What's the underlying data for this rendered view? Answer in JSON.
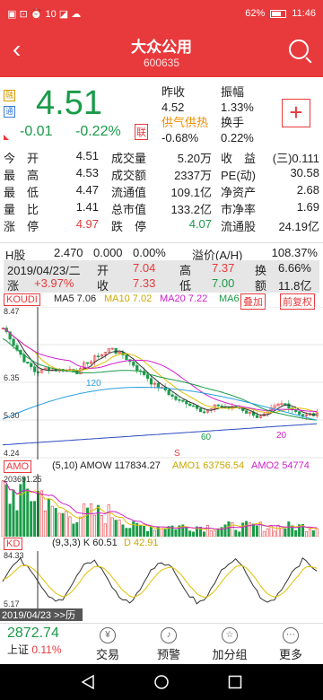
{
  "status": {
    "left_icons": "▣ ⊡ ⏰ 10 ◪ ☁",
    "battery_pct": "62%",
    "time": "11:46"
  },
  "header": {
    "title": "大众公用",
    "code": "600635"
  },
  "quote": {
    "tag1": "融",
    "tag2": "通",
    "price": "4.51",
    "change": "-0.01",
    "change_pct": "-0.22%",
    "lian": "联",
    "zuoshou_label": "昨收",
    "zuoshou": "4.52",
    "zhenfu_label": "振幅",
    "zhenfu": "1.33%",
    "gongqi_label": "供气供热",
    "gongqi": "-0.68%",
    "huanshou_label": "换手",
    "huanshou": "0.22%"
  },
  "stats": [
    [
      {
        "k": "今　开",
        "v": "4.51",
        "c": ""
      },
      {
        "k": "成交量",
        "v": "5.20万",
        "c": ""
      },
      {
        "k": "收　益",
        "v": "(三)0.111",
        "c": ""
      }
    ],
    [
      {
        "k": "最　高",
        "v": "4.53",
        "c": ""
      },
      {
        "k": "成交额",
        "v": "2337万",
        "c": ""
      },
      {
        "k": "PE(动)",
        "v": "30.58",
        "c": ""
      }
    ],
    [
      {
        "k": "最　低",
        "v": "4.47",
        "c": ""
      },
      {
        "k": "流通值",
        "v": "109.1亿",
        "c": ""
      },
      {
        "k": "净资产",
        "v": "2.68",
        "c": ""
      }
    ],
    [
      {
        "k": "量　比",
        "v": "1.41",
        "c": ""
      },
      {
        "k": "总市值",
        "v": "133.2亿",
        "c": ""
      },
      {
        "k": "市净率",
        "v": "1.69",
        "c": ""
      }
    ],
    [
      {
        "k": "涨　停",
        "v": "4.97",
        "c": "red"
      },
      {
        "k": "跌　停",
        "v": "4.07",
        "c": "green"
      },
      {
        "k": "流通股",
        "v": "24.19亿",
        "c": ""
      }
    ]
  ],
  "hshare": {
    "label": "H股",
    "v1": "2.470",
    "v2": "0.000",
    "v3": "0.00%",
    "premium_label": "溢价(A/H)",
    "premium": "108.37%"
  },
  "day": {
    "date": "2019/04/23/二",
    "open_label": "开",
    "open": "7.04",
    "high_label": "高",
    "high": "7.37",
    "turn_label": "换",
    "turn": "6.66%",
    "chg_label": "涨",
    "chg": "+3.97%",
    "close_label": "收",
    "close": "7.33",
    "low_label": "低",
    "low": "7.00",
    "amt_label": "额",
    "amt": "11.8亿"
  },
  "kbar": {
    "name": "KOUDI",
    "ma5": "MA5 7.06",
    "ma10": "MA10 7.02",
    "ma20": "MA20 7.22",
    "ma60": "MA6",
    "overlay": "叠加",
    "fq": "前复权"
  },
  "kchart": {
    "p1": "8.47",
    "p2": "6.35",
    "p3": "5.30",
    "p4": "4.24",
    "ann1": "120",
    "ann2": "60",
    "ann3": "20",
    "ann4": "S"
  },
  "amo": {
    "name": "AMO",
    "text": "(5,10) AMOW 117834.27",
    "amo1": "AMO1 63756.54",
    "amo2": "AMO2 54774",
    "max": "203691.25"
  },
  "kd": {
    "name": "KD",
    "text": "(9,3,3) K 60.51",
    "d": "D 42.91",
    "top": "84.33",
    "bottom": "5.17",
    "date": "2019/04/23 >>历"
  },
  "nav": {
    "index_value": "2872.74",
    "index_label": "上证",
    "index_pct": "0.11%",
    "items": [
      {
        "icon": "¥",
        "label": "交易"
      },
      {
        "icon": "♪",
        "label": "预警"
      },
      {
        "icon": "☆",
        "label": "加分组"
      },
      {
        "icon": "⋯",
        "label": "更多"
      }
    ]
  },
  "colors": {
    "accent": "#e8393c",
    "up": "#e8393c",
    "down": "#1a9b48",
    "ma5": "#333333",
    "ma10": "#e0c000",
    "ma20": "#d020d0",
    "ma60": "#1a9b48"
  }
}
